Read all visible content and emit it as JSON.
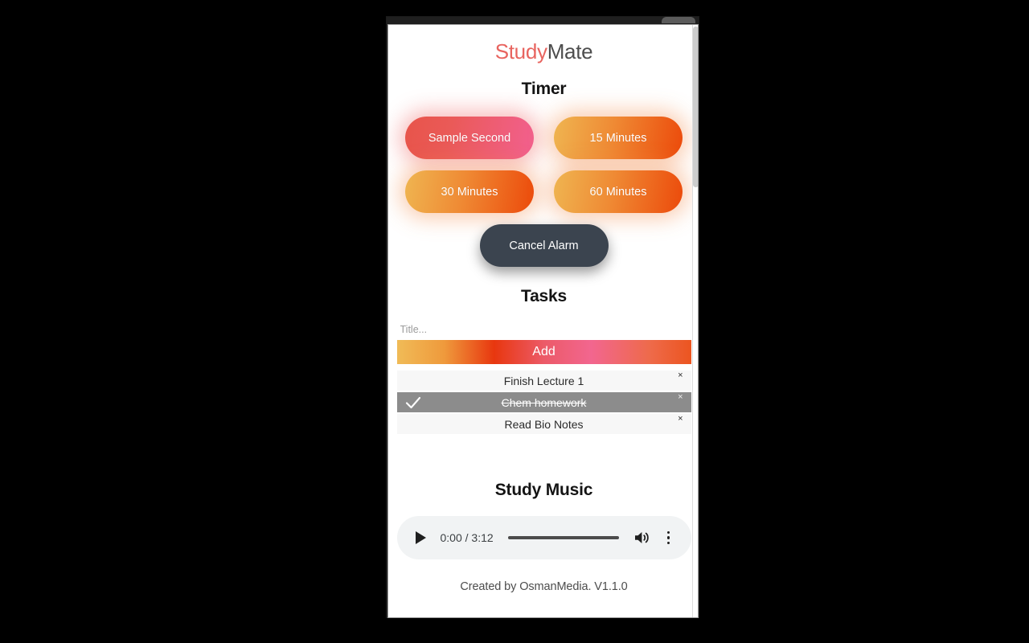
{
  "window": {
    "tab_label": ""
  },
  "brand": {
    "part_one": "Study",
    "part_two": "Mate",
    "color_primary": "#e8645f",
    "color_secondary": "#4d4d4d"
  },
  "timer": {
    "heading": "Timer",
    "buttons": [
      {
        "label": "Sample Second",
        "style": "pink"
      },
      {
        "label": "15 Minutes",
        "style": "orange"
      },
      {
        "label": "30 Minutes",
        "style": "orange"
      },
      {
        "label": "60 Minutes",
        "style": "orange"
      }
    ],
    "cancel_label": "Cancel Alarm",
    "cancel_color": "#3b444f"
  },
  "tasks": {
    "heading": "Tasks",
    "input_placeholder": "Title...",
    "input_value": "",
    "add_label": "Add",
    "delete_glyph": "×",
    "items": [
      {
        "label": "Finish Lecture 1",
        "done": false
      },
      {
        "label": "Chem homework",
        "done": true
      },
      {
        "label": "Read Bio Notes",
        "done": false
      }
    ]
  },
  "music": {
    "heading": "Study Music",
    "current_time": "0:00",
    "duration": "3:12",
    "time_display": "0:00 / 3:12",
    "progress_percent": 0,
    "play_icon": "play-icon",
    "volume_icon": "volume-icon",
    "menu_icon": "overflow-menu-icon"
  },
  "footer": {
    "credit": "Created by OsmanMedia. V1.1.0"
  }
}
